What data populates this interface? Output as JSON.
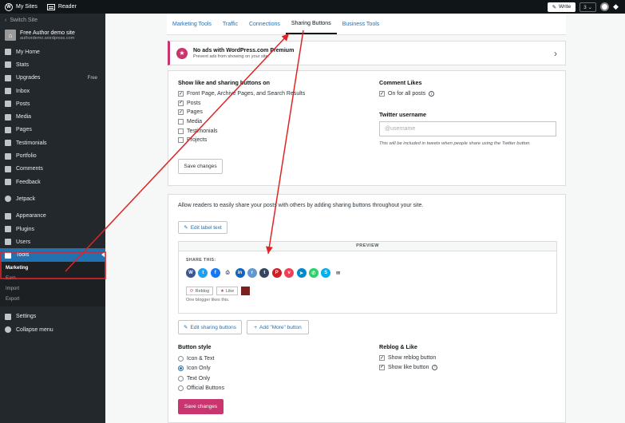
{
  "topbar": {
    "my_sites": "My Sites",
    "reader": "Reader",
    "write": "Write",
    "notif_count": "3"
  },
  "sidebar": {
    "switch_site": "Switch Site",
    "site_name": "Free Author demo site",
    "site_url": "authordemo.wordpress.com",
    "items": [
      {
        "label": "My Home",
        "icon": "home-icon"
      },
      {
        "label": "Stats",
        "icon": "stats-icon"
      },
      {
        "label": "Upgrades",
        "icon": "cart-icon",
        "badge": "Free"
      },
      {
        "label": "Inbox",
        "icon": "inbox-icon"
      },
      {
        "label": "Posts",
        "icon": "pin-icon"
      },
      {
        "label": "Media",
        "icon": "media-icon"
      },
      {
        "label": "Pages",
        "icon": "pages-icon"
      },
      {
        "label": "Testimonials",
        "icon": "testimonials-icon"
      },
      {
        "label": "Portfolio",
        "icon": "portfolio-icon"
      },
      {
        "label": "Comments",
        "icon": "comments-icon"
      },
      {
        "label": "Feedback",
        "icon": "feedback-icon"
      },
      {
        "label": "Jetpack",
        "icon": "jetpack-icon"
      },
      {
        "label": "Appearance",
        "icon": "appearance-icon"
      },
      {
        "label": "Plugins",
        "icon": "plugins-icon"
      },
      {
        "label": "Users",
        "icon": "users-icon"
      },
      {
        "label": "Tools",
        "icon": "tools-icon"
      }
    ],
    "sub_items": [
      "Marketing",
      "Earn",
      "Import",
      "Export"
    ],
    "settings": "Settings",
    "collapse": "Collapse menu"
  },
  "tabs": [
    "Marketing Tools",
    "Traffic",
    "Connections",
    "Sharing Buttons",
    "Business Tools"
  ],
  "active_tab": "Sharing Buttons",
  "promo": {
    "title": "No ads with WordPress.com Premium",
    "subtitle": "Prevent ads from showing on your site."
  },
  "likes_section": {
    "title": "Show like and sharing buttons on",
    "options": [
      {
        "label": "Front Page, Archive Pages, and Search Results",
        "checked": true
      },
      {
        "label": "Posts",
        "checked": true
      },
      {
        "label": "Pages",
        "checked": true
      },
      {
        "label": "Media",
        "checked": false
      },
      {
        "label": "Testimonials",
        "checked": false
      },
      {
        "label": "Projects",
        "checked": false
      }
    ],
    "save": "Save changes"
  },
  "comment_likes": {
    "title": "Comment Likes",
    "option": "On for all posts",
    "checked": true
  },
  "twitter": {
    "title": "Twitter username",
    "placeholder": "@username",
    "help": "This will be included in tweets when people share using the Twitter button."
  },
  "sharing": {
    "intro": "Allow readers to easily share your posts with others by adding sharing buttons throughout your site.",
    "edit_label": "Edit label text",
    "preview": "PREVIEW",
    "share_this": "SHARE THIS:",
    "icons": [
      {
        "name": "wordpress-icon",
        "color": "#3a5795",
        "glyph": "W"
      },
      {
        "name": "twitter-icon",
        "color": "#1da1f2",
        "glyph": "t"
      },
      {
        "name": "facebook-icon",
        "color": "#1877f2",
        "glyph": "f"
      },
      {
        "name": "print-icon",
        "color": "",
        "glyph": "⎙"
      },
      {
        "name": "linkedin-icon",
        "color": "#0a66c2",
        "glyph": "in"
      },
      {
        "name": "reddit-icon",
        "color": "#5f99cf",
        "glyph": "r"
      },
      {
        "name": "tumblr-icon",
        "color": "#35465c",
        "glyph": "t"
      },
      {
        "name": "pinterest-icon",
        "color": "#cb2027",
        "glyph": "P"
      },
      {
        "name": "pocket-icon",
        "color": "#ee4056",
        "glyph": "v"
      },
      {
        "name": "telegram-icon",
        "color": "#0088cc",
        "glyph": "➤"
      },
      {
        "name": "whatsapp-icon",
        "color": "#25d366",
        "glyph": "✆"
      },
      {
        "name": "skype-icon",
        "color": "#00aff0",
        "glyph": "S"
      },
      {
        "name": "email-icon",
        "color": "",
        "glyph": "✉"
      }
    ],
    "reblog": "Reblog",
    "like": "Like",
    "likes_text": "One blogger likes this.",
    "edit_buttons": "Edit sharing buttons",
    "add_more": "Add \"More\" button"
  },
  "button_style": {
    "title": "Button style",
    "options": [
      "Icon & Text",
      "Icon Only",
      "Text Only",
      "Official Buttons"
    ],
    "selected": "Icon Only"
  },
  "reblog_like": {
    "title": "Reblog & Like",
    "options": [
      {
        "label": "Show reblog button",
        "checked": true
      },
      {
        "label": "Show like button",
        "checked": true
      }
    ]
  },
  "save_bottom": "Save changes",
  "colors": {
    "accent": "#2271b1",
    "brand_pink": "#c9356e",
    "annotation": "#e02424",
    "sidebar": "#23282d"
  }
}
